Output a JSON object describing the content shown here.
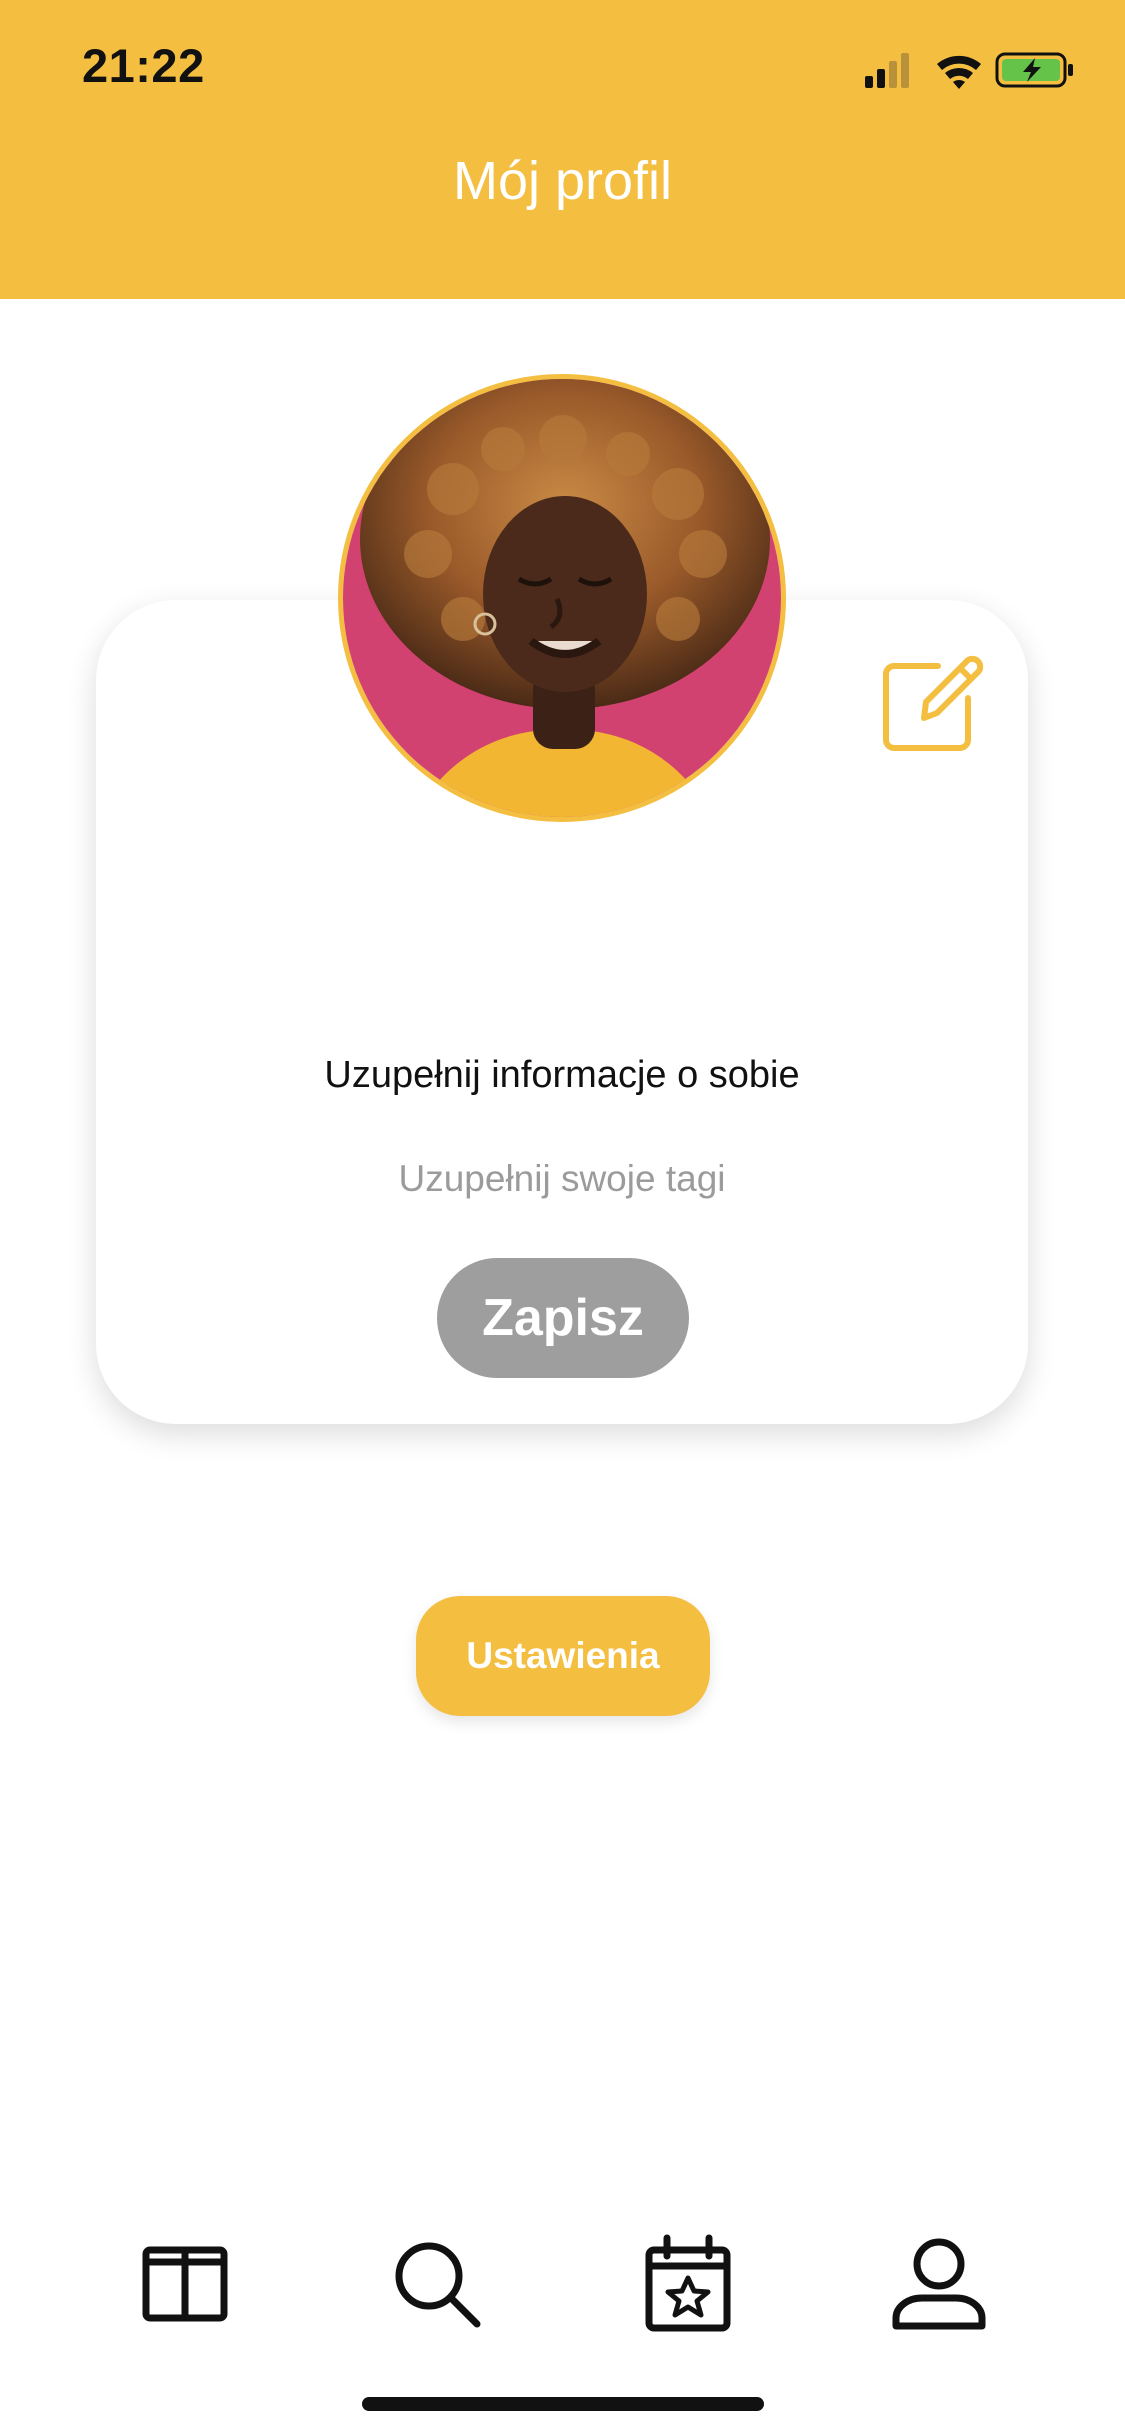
{
  "status_bar": {
    "time": "21:22"
  },
  "header": {
    "title": "Mój profil"
  },
  "profile_card": {
    "about_prompt": "Uzupełnij informacje o sobie",
    "tags_placeholder": "Uzupełnij swoje tagi",
    "save_label": "Zapisz"
  },
  "settings": {
    "label": "Ustawienia"
  },
  "bottom_nav": {
    "items": [
      {
        "icon": "columns-icon"
      },
      {
        "icon": "search-icon"
      },
      {
        "icon": "calendar-star-icon"
      },
      {
        "icon": "user-icon"
      }
    ]
  },
  "colors": {
    "accent": "#F4BE41",
    "save_button": "#9E9E9E",
    "text_primary": "#111111",
    "text_muted": "#9B9B9B"
  }
}
